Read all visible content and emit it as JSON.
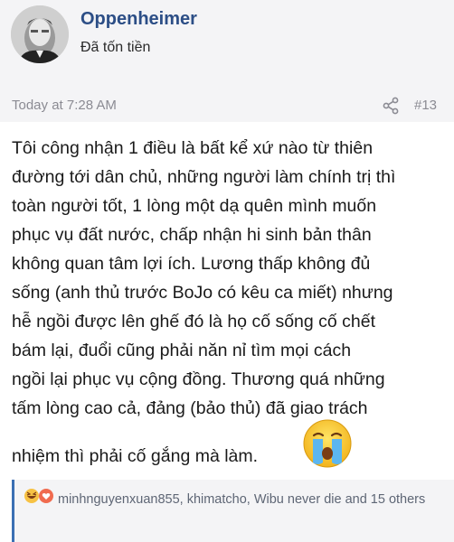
{
  "post": {
    "author": {
      "username": "Oppenheimer",
      "title": "Đã tốn tiền",
      "avatar_icon": "avatar-photo"
    },
    "timestamp": "Today at 7:28 AM",
    "post_number": "#13",
    "share_icon": "share-icon",
    "body_lines": [
      "Tôi công nhận 1 điều là bất kể xứ nào từ thiên",
      "đường tới dân chủ, những người làm chính trị thì",
      "toàn người tốt, 1 lòng một dạ quên mình muốn",
      "phục vụ đất nước, chấp nhận hi sinh bản thân",
      "không quan tâm lợi ích. Lương thấp không đủ",
      "sống (anh thủ trước BoJo có kêu ca miết) nhưng",
      "hễ ngồi được lên ghế đó là họ cố sống cố chết",
      "bám lại, đuổi cũng phải năn nỉ tìm mọi cách",
      "ngồi lại phục vụ cộng đồng. Thương quá những",
      "tấm lòng cao cả, đảng (bảo thủ) đã giao trách"
    ],
    "body_last_line": "nhiệm thì phải cố gắng mà làm.",
    "emoji": "crying-face",
    "reactions": {
      "icons": [
        "haha-reaction",
        "love-reaction"
      ],
      "text": "minhnguyenxuan855, khimatcho, Wibu never die and 15 others"
    }
  },
  "colors": {
    "username": "#2c4e86",
    "header_bg": "#f4f4f6",
    "meta_text": "#8b8b93",
    "reaction_border": "#3b6fb3"
  }
}
